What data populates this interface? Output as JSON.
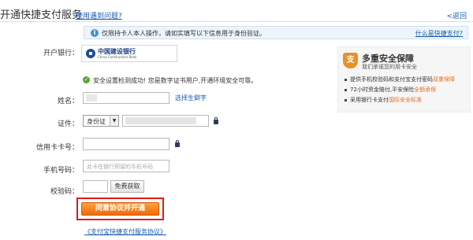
{
  "header": {
    "title": "开通快捷支付服务",
    "help_link": "使用遇到问题?",
    "back_link": "<返回"
  },
  "notice": {
    "text": "仅限持卡人本人操作，请如实填写以下信息用于身份验证。",
    "link": "什么是快捷支付?"
  },
  "bank": {
    "label": "开户银行：",
    "logo_name": "中国建设银行",
    "logo_en": "China Construction Bank",
    "logo_icon": "ccb-logo-icon"
  },
  "security": {
    "message": "安全设置检测成功! 您是数字证书用户,开通环境安全可靠。",
    "icon": "check-circle-icon",
    "color": "#55a532"
  },
  "form": {
    "name_label": "姓名：",
    "rare_char_link": "选择生僻字",
    "cert_label": "证件：",
    "cert_type": "身份证",
    "card_label": "信用卡卡号：",
    "phone_label": "手机号码：",
    "phone_placeholder": "此卡在银行预留的手机号码",
    "code_label": "校验码：",
    "code_button": "免费获取",
    "submit": "同意协议并开通",
    "agreement": "《支付宝快捷支付服务协议》"
  },
  "side_panel": {
    "title": "多重安全保障",
    "subtitle": "我们承诺您的用卡安全",
    "items": [
      {
        "text": "提供手机校验码和支付宝支付密码",
        "highlight": "双重保障"
      },
      {
        "text": "72小时资金赔付,平安保险",
        "highlight": "全额承保"
      },
      {
        "text": "采用银行卡支付",
        "highlight": "国际安全标准"
      }
    ],
    "accent": "#e8701a"
  },
  "colors": {
    "link": "#1b5cab",
    "submit": "#ee6a07",
    "highlight_border": "#e21b1b"
  }
}
